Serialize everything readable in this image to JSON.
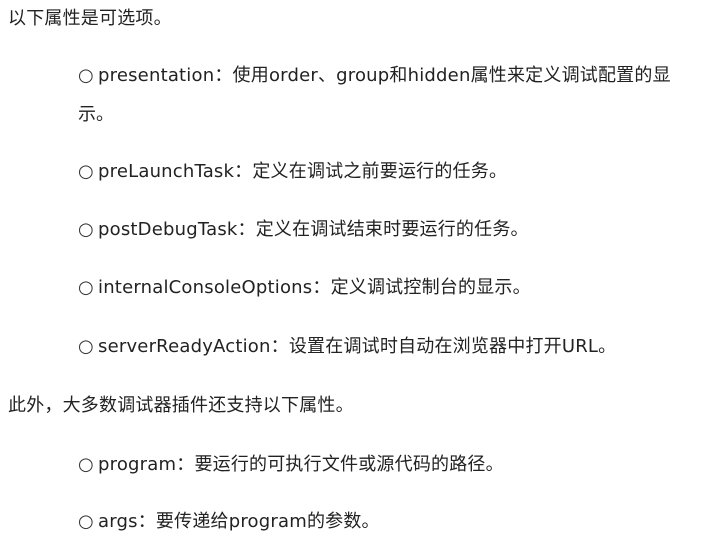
{
  "intro": "以下属性是可选项。",
  "bullet_mark": "○",
  "list1": [
    {
      "key": "presentation",
      "sep": "：",
      "desc": "使用order、group和hidden属性来定义调试配置的显",
      "desc_cont": "示。"
    },
    {
      "key": "preLaunchTask",
      "sep": "：",
      "desc": "定义在调试之前要运行的任务。"
    },
    {
      "key": "postDebugTask",
      "sep": "：",
      "desc": "定义在调试结束时要运行的任务。"
    },
    {
      "key": "internalConsoleOptions",
      "sep": "：",
      "desc": "定义调试控制台的显示。"
    },
    {
      "key": "serverReadyAction",
      "sep": "：",
      "desc": "设置在调试时自动在浏览器中打开URL。"
    }
  ],
  "middle": "此外，大多数调试器插件还支持以下属性。",
  "list2": [
    {
      "key": "program",
      "sep": "：",
      "desc": "要运行的可执行文件或源代码的路径。"
    },
    {
      "key": "args",
      "sep": "：",
      "desc": "要传递给program的参数。"
    }
  ]
}
